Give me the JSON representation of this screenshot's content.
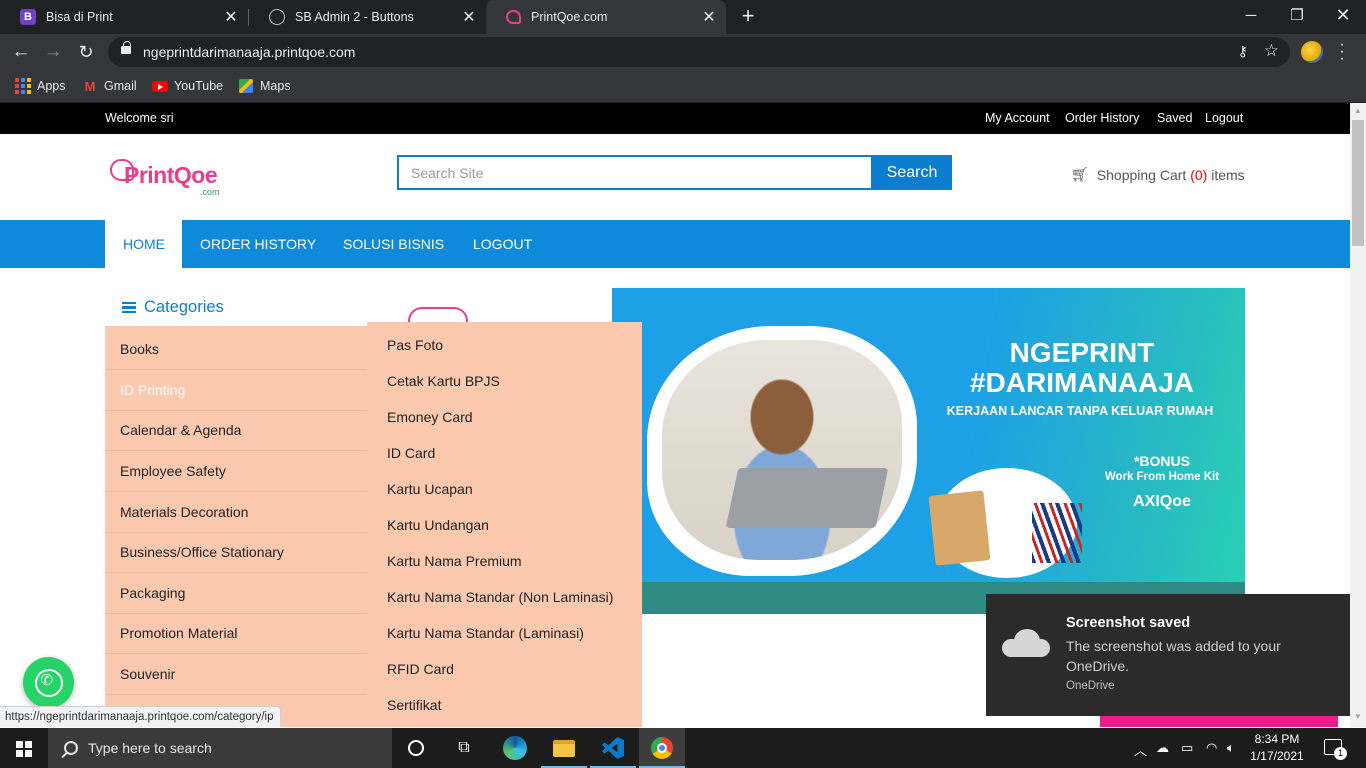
{
  "browser": {
    "tabs": [
      {
        "title": "Bisa di Print",
        "favicon": "B"
      },
      {
        "title": "SB Admin 2 - Buttons",
        "favicon": "globe-icon"
      },
      {
        "title": "PrintQoe.com",
        "favicon": "printqoe-icon"
      }
    ],
    "url": "ngeprintdarimanaaja.printqoe.com",
    "bookmarks": [
      "Apps",
      "Gmail",
      "YouTube",
      "Maps"
    ]
  },
  "site": {
    "welcome": "Welcome sri",
    "top_links": [
      "My Account",
      "Order History",
      "Saved",
      "Logout"
    ],
    "logo_text": "PrintQoe",
    "logo_sub": ".com",
    "search_placeholder": "Search Site",
    "search_button": "Search",
    "cart_label": "Shopping Cart",
    "cart_count": "(0)",
    "cart_suffix": "items",
    "nav": [
      "HOME",
      "ORDER HISTORY",
      "SOLUSI BISNIS",
      "LOGOUT"
    ],
    "categories_title": "Categories",
    "categories": [
      "Books",
      "ID Printing",
      "Calendar & Agenda",
      "Employee Safety",
      "Materials Decoration",
      "Business/Office Stationary",
      "Packaging",
      "Promotion Material",
      "Souvenir"
    ],
    "submenu": [
      "Pas Foto",
      "Cetak Kartu BPJS",
      "Emoney Card",
      "ID Card",
      "Kartu Ucapan",
      "Kartu Undangan",
      "Kartu Nama Premium",
      "Kartu Nama Standar (Non Laminasi)",
      "Kartu Nama Standar (Laminasi)",
      "RFID Card",
      "Sertifikat"
    ],
    "banner": {
      "heading_1": "NGEPRINT",
      "heading_2": "#DARIMANAAJA",
      "subheading": "KERJAAN LANCAR TANPA KELUAR RUMAH",
      "bonus": "*BONUS",
      "bonus_detail": "Work From Home Kit",
      "partner": "AXIQoe"
    },
    "status_url": "https://ngeprintdarimanaaja.printqoe.com/category/ip"
  },
  "toast": {
    "title": "Screenshot saved",
    "body": "The screenshot was added to your OneDrive.",
    "source": "OneDrive"
  },
  "taskbar": {
    "search_placeholder": "Type here to search",
    "time": "8:34 PM",
    "date": "1/17/2021",
    "notification_count": "1"
  },
  "colors": {
    "brand_blue": "#0d7ecf",
    "brand_pink": "#e83e8c",
    "category_bg": "#fdc9ae"
  }
}
